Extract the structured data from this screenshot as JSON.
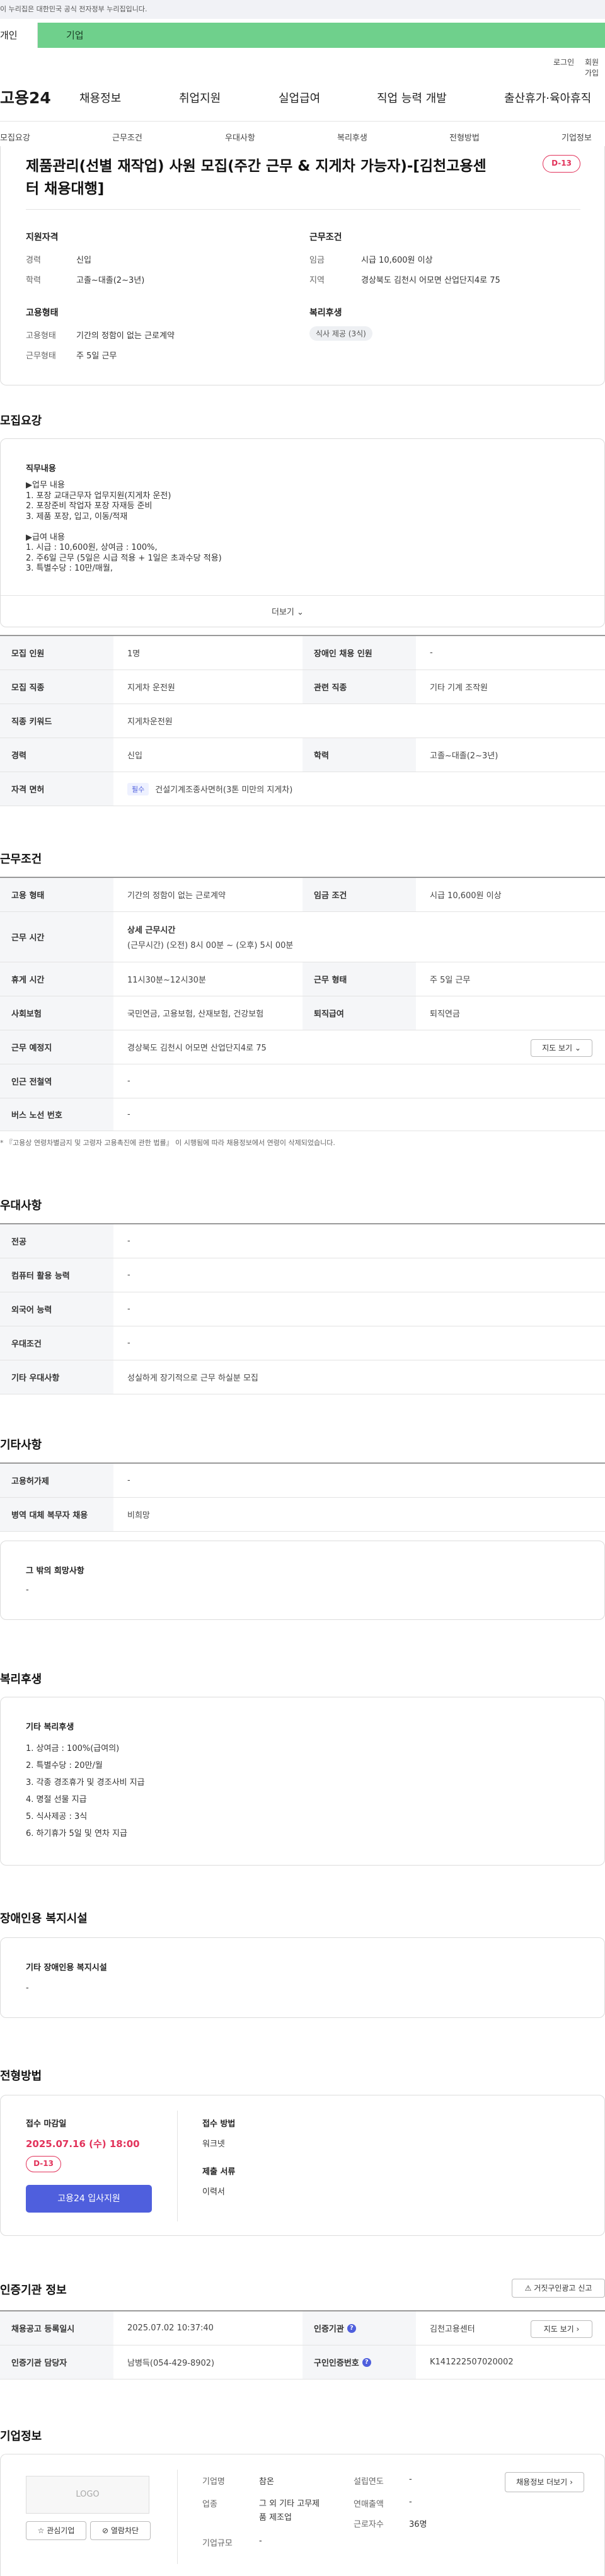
{
  "banner": {
    "text": "이 누리집은 대한민국 공식 전자정부 누리집입니다."
  },
  "tabs": {
    "personal": "개인",
    "corporate": "기업"
  },
  "util": {
    "login": "로그인",
    "join": "회원가입"
  },
  "logo": "고용24",
  "gnb": [
    "채용정보",
    "취업지원",
    "실업급여",
    "직업 능력 개발",
    "출산휴가·육아휴직"
  ],
  "anchors": [
    "모집요강",
    "근무조건",
    "우대사항",
    "복리후생",
    "전형방법",
    "기업정보"
  ],
  "job": {
    "title_line1": "제품관리(선별 재작업) 사원 모집(주간 근무 & 지게차 가능자)-[김천고용센",
    "title_line2": "터 채용대행]",
    "dday": "D-13",
    "qual_heading": "지원자격",
    "career_label": "경력",
    "career": "신입",
    "edu_label": "학력",
    "edu": "고졸~대졸(2~3년)",
    "cond_heading": "근무조건",
    "wage_label": "임금",
    "wage": "시급 10,600원 이상",
    "region_label": "지역",
    "region": "경상북도 김천시 어모면 산업단지4로 75",
    "emp_heading": "고용형태",
    "emptype_label": "고용형태",
    "emptype": "기간의 정함이 없는 근로계약",
    "workform_label": "근무형태",
    "workform": "주 5일 근무",
    "welfare_heading": "복리후생",
    "welfare_chip": "식사 제공 (3식)"
  },
  "recruit": {
    "title": "모집요강",
    "duty_title": "직무내용",
    "duty_lines": [
      "▶업무 내용",
      "1. 포장 교대근무자 업무지원(지게차 운전)",
      "2. 포장준비 작업자 포장 자재등 준비",
      "3. 제품 포장, 입고, 이동/적재",
      "",
      "▶급여 내용",
      "1. 시급 : 10,600원, 상여금 : 100%,",
      "2. 주6일 근무 (5일은 시급 적용 + 1일은 초과수당 적용)",
      "3. 특별수당 : 10만/매월,"
    ],
    "more": "더보기",
    "rows": [
      {
        "l1": "모집 인원",
        "v1": "1명",
        "l2": "장애인 채용 인원",
        "v2": "-"
      },
      {
        "l1": "모집 직종",
        "v1": "지게차 운전원",
        "l2": "관련 직종",
        "v2": "기타 기계 조작원"
      },
      {
        "l1": "직종 키워드",
        "v1": "지게차운전원",
        "l2": "",
        "v2": ""
      },
      {
        "l1": "경력",
        "v1": "신입",
        "l2": "학력",
        "v2": "고졸~대졸(2~3년)"
      },
      {
        "l1": "자격 면허",
        "v1": "건설기계조종사면허(3톤 미만의 지게차)",
        "l2": "",
        "v2": ""
      }
    ],
    "license_badge": "필수"
  },
  "conditions": {
    "title": "근무조건",
    "emptype_l": "고용 형태",
    "emptype_v": "기간의 정함이 없는 근로계약",
    "wagecond_l": "임금 조건",
    "wagecond_v": "시급 10,600원 이상",
    "worktime_l": "근무 시간",
    "worktime_h": "상세 근무시간",
    "worktime_v": "(근무시간) (오전) 8시 00분 ~ (오후) 5시 00분",
    "rest_l": "휴게 시간",
    "rest_v": "11시30분~12시30분",
    "form_l": "근무 형태",
    "form_v": "주 5일 근무",
    "ins_l": "사회보험",
    "ins_v": "국민연금, 고용보험, 산재보험, 건강보험",
    "retire_l": "퇴직급여",
    "retire_v": "퇴직연금",
    "place_l": "근무 예정지",
    "place_v": "경상북도 김천시 어모면 산업단지4로 75",
    "map_btn": "지도 보기",
    "subway_l": "인근 전철역",
    "subway_v": "-",
    "bus_l": "버스 노선 번호",
    "bus_v": "-",
    "notice": "* 『고용상 연령차별금지 및 고령자 고용촉진에 관한 법률』 이 시행됨에 따라 채용정보에서 연령이 삭제되었습니다."
  },
  "preference": {
    "title": "우대사항",
    "rows": [
      {
        "l": "전공",
        "v": "-"
      },
      {
        "l": "컴퓨터 활용 능력",
        "v": "-"
      },
      {
        "l": "외국어 능력",
        "v": "-"
      },
      {
        "l": "우대조건",
        "v": "-"
      },
      {
        "l": "기타 우대사항",
        "v": "성실하게 장기적으로 근무 하실분 모집"
      }
    ]
  },
  "etc": {
    "title": "기타사항",
    "rows": [
      {
        "l": "고용허가제",
        "v": "-"
      },
      {
        "l": "병역 대체 복무자 채용",
        "v": "비희망"
      }
    ],
    "hope_title": "그 밖의 희망사항",
    "hope_value": "-"
  },
  "welfare": {
    "title": "복리후생",
    "sub": "기타 복리후생",
    "items": [
      "1. 상여금 : 100%(급여의)",
      "2. 특별수당 : 20만/월",
      "3. 각종 경조휴가 및 경조사비 지급",
      "4. 명절 선물 지급",
      "5. 식사제공 : 3식",
      "6. 하기휴가 5일 및 연차 지급"
    ]
  },
  "disabled": {
    "title": "장애인용 복지시설",
    "sub": "기타 장애인용 복지시설",
    "value": "-"
  },
  "process": {
    "title": "전형방법",
    "deadline_l": "접수 마감일",
    "deadline": "2025.07.16 (수) 18:00",
    "dday": "D-13",
    "apply_btn": "고용24 입사지원",
    "method_l": "접수 방법",
    "method": "워크넷",
    "docs_l": "제출 서류",
    "docs": "이력서"
  },
  "cert": {
    "title": "인증기관 정보",
    "report_btn": "거짓구인광고 신고",
    "reg_l": "채용공고 등록일시",
    "reg_v": "2025.07.02 10:37:40",
    "org_l": "인증기관",
    "org_v": "김천고용센터",
    "map_btn": "지도 보기",
    "manager_l": "인증기관 담당자",
    "manager_v": "남병득(054-429-8902)",
    "no_l": "구인인증번호",
    "no_v": "K141222507020002"
  },
  "company": {
    "title": "기업정보",
    "logo_text": "LOGO",
    "interest_btn": "관심기업",
    "block_btn": "열람차단",
    "name_l": "기업명",
    "name_v": "참온",
    "industry_l": "업종",
    "industry_v1": "그 외 기타 고무제",
    "industry_v2": "품 제조업",
    "scale_l": "기업규모",
    "scale_v": "-",
    "year_l": "설립연도",
    "year_v": "-",
    "sales_l": "연매출액",
    "sales_v": "-",
    "emp_l": "근로자수",
    "emp_v": "36명",
    "jobs_btn": "채용정보 더보기"
  },
  "colors": {
    "accent": "#4f5fdd",
    "danger": "#e2335b",
    "green_tab": "#6fd08c"
  }
}
